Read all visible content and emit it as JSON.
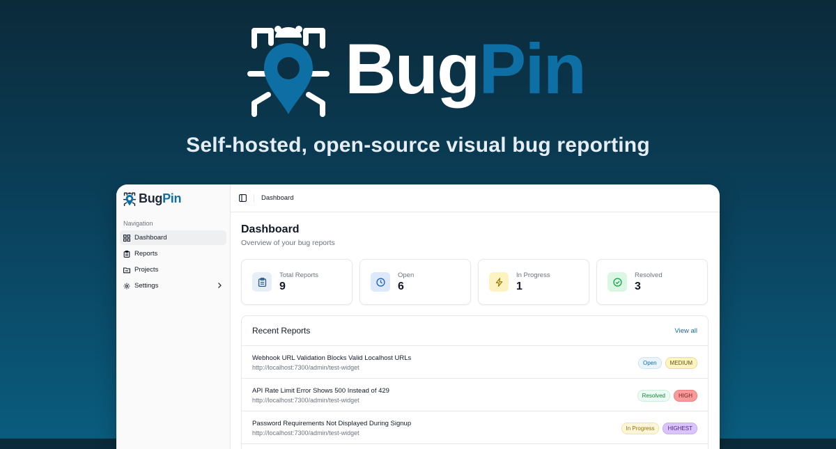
{
  "hero": {
    "brand_part1": "Bug",
    "brand_part2": "Pin",
    "tagline": "Self-hosted, open-source visual bug reporting"
  },
  "sidebar": {
    "brand_part1": "Bug",
    "brand_part2": "Pin",
    "nav_heading": "Navigation",
    "items": [
      {
        "label": "Dashboard",
        "icon": "grid-icon",
        "active": true
      },
      {
        "label": "Reports",
        "icon": "clipboard-icon"
      },
      {
        "label": "Projects",
        "icon": "folder-icon"
      },
      {
        "label": "Settings",
        "icon": "gear-icon",
        "has_submenu": true
      }
    ]
  },
  "topbar": {
    "breadcrumb": "Dashboard"
  },
  "main": {
    "title": "Dashboard",
    "subtitle": "Overview of your bug reports",
    "stats": [
      {
        "label": "Total Reports",
        "value": "9",
        "icon": "clipboard-icon"
      },
      {
        "label": "Open",
        "value": "6",
        "icon": "clock-icon"
      },
      {
        "label": "In Progress",
        "value": "1",
        "icon": "lightning-icon"
      },
      {
        "label": "Resolved",
        "value": "3",
        "icon": "check-circle-icon"
      }
    ],
    "recent": {
      "title": "Recent Reports",
      "view_all": "View all",
      "rows": [
        {
          "title": "Webhook URL Validation Blocks Valid Localhost URLs",
          "url": "http://localhost:7300/admin/test-widget",
          "status": "Open",
          "priority": "MEDIUM"
        },
        {
          "title": "API Rate Limit Error Shows 500 Instead of 429",
          "url": "http://localhost:7300/admin/test-widget",
          "status": "Resolved",
          "priority": "HIGH"
        },
        {
          "title": "Password Requirements Not Displayed During Signup",
          "url": "http://localhost:7300/admin/test-widget",
          "status": "In Progress",
          "priority": "HIGHEST"
        }
      ]
    }
  },
  "colors": {
    "brand_blue": "#0e6fa5",
    "background_top": "#0b2a3a",
    "background_bottom": "#0a5c7e"
  }
}
